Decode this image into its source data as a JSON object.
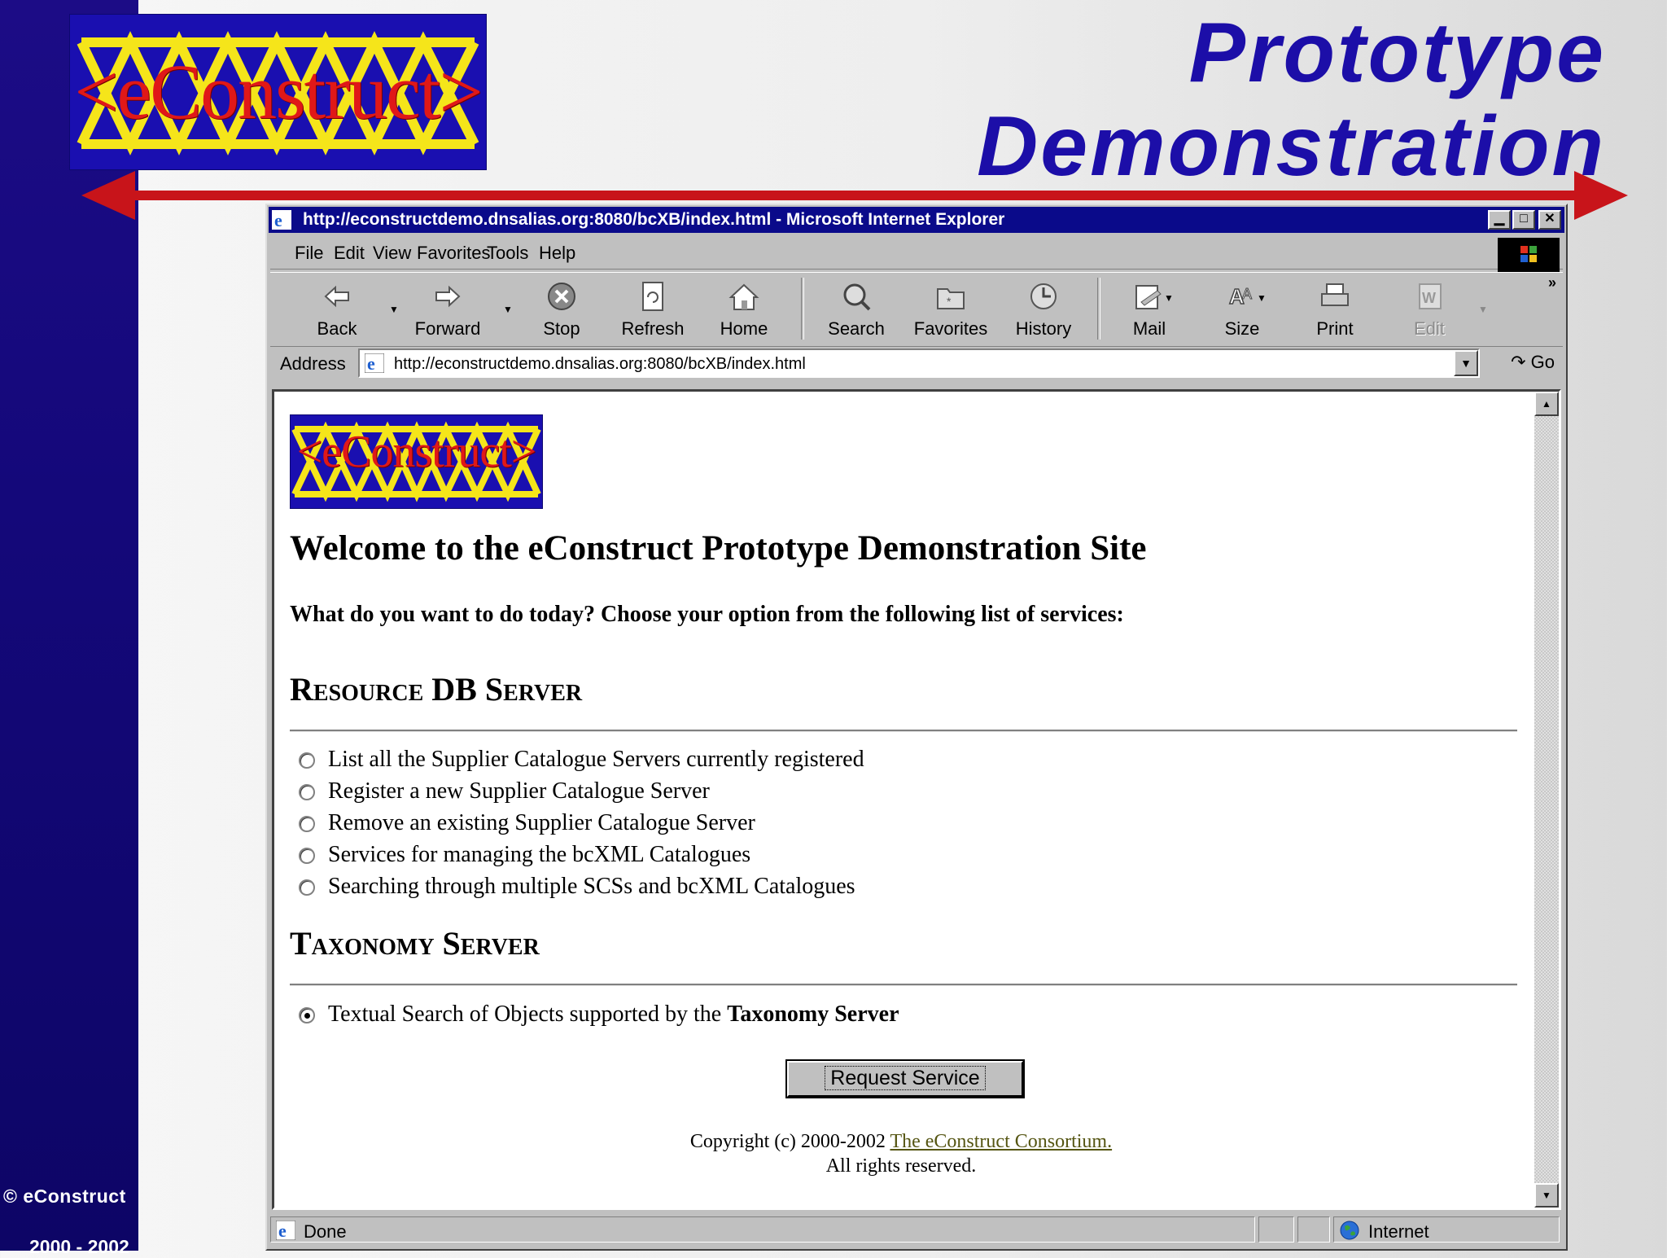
{
  "slide": {
    "title_line1": "Prototype",
    "title_line2": "Demonstration",
    "side_copyright": "© eConstruct",
    "side_years": "2000 - 2002",
    "logo_text": "<eConstruct>"
  },
  "browser": {
    "title": "http://econstructdemo.dnsalias.org:8080/bcXB/index.html - Microsoft Internet Explorer",
    "menu": [
      "File",
      "Edit",
      "View",
      "Favorites",
      "Tools",
      "Help"
    ],
    "toolbar": {
      "back": "Back",
      "forward": "Forward",
      "stop": "Stop",
      "refresh": "Refresh",
      "home": "Home",
      "search": "Search",
      "favorites": "Favorites",
      "history": "History",
      "mail": "Mail",
      "size": "Size",
      "print": "Print",
      "edit": "Edit"
    },
    "address_label": "Address",
    "address_value": "http://econstructdemo.dnsalias.org:8080/bcXB/index.html",
    "go_label": "Go",
    "status_text": "Done",
    "zone_text": "Internet"
  },
  "page": {
    "logo_text": "<eConstruct>",
    "welcome": "Welcome to the eConstruct Prototype Demonstration Site",
    "intro": "What do you want to do today? Choose your option from the following list of services:",
    "section1": "Resource DB Server",
    "options1": [
      "List all the Supplier Catalogue Servers currently registered",
      "Register a new Supplier Catalogue Server",
      "Remove an existing Supplier Catalogue Server",
      "Services for managing the bcXML Catalogues",
      "Searching through multiple SCSs and bcXML Catalogues"
    ],
    "section2": "Taxonomy Server",
    "option2_prefix": "Textual Search of Objects supported by the",
    "option2_bold": "Taxonomy Server",
    "button": "Request Service",
    "copyright_prefix": "Copyright (c) 2000-2002",
    "copyright_link": "The eConstruct Consortium.",
    "rights": "All rights reserved."
  },
  "colors": {
    "title_blue": "#1c0ea8",
    "side_bar": "#14087a",
    "arrow_red": "#c8141a",
    "logo_lattice": "#f5e51a",
    "logo_text": "#e01818"
  }
}
